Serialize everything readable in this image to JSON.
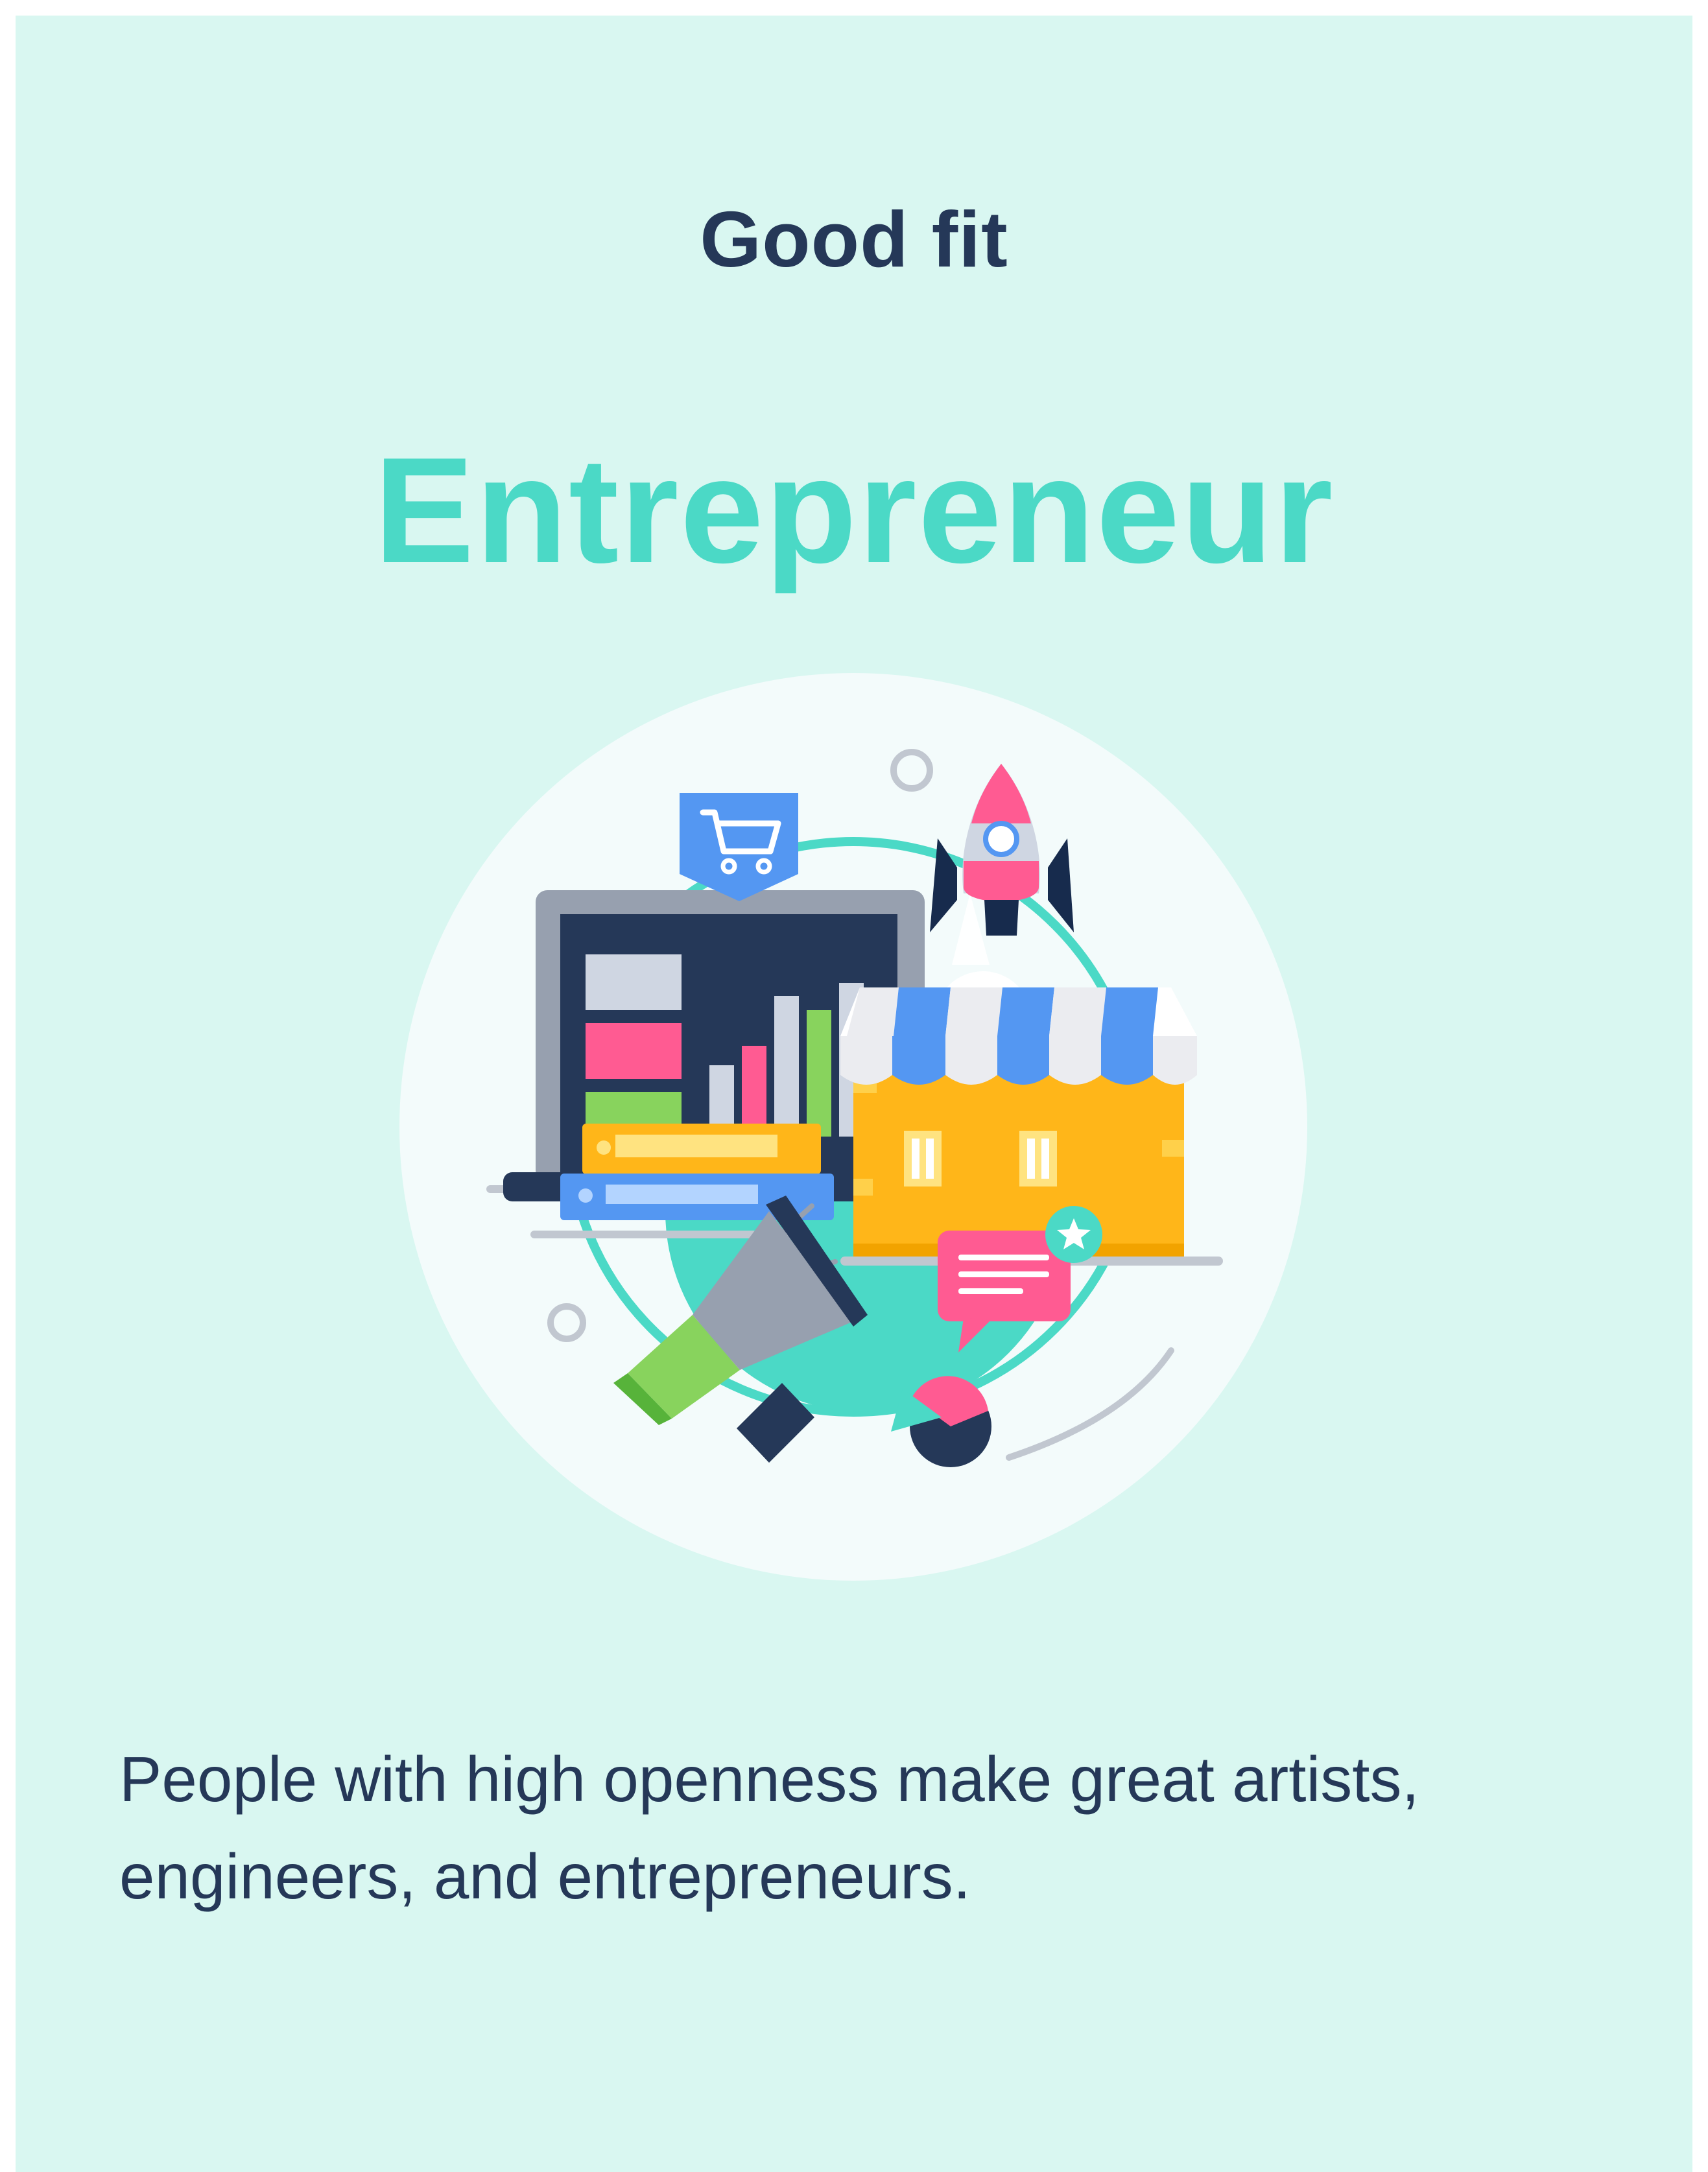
{
  "card": {
    "label": "Good fit",
    "title": "Entrepreneur",
    "description": "People with high openness make great artists, engineers, and entrepreneurs."
  },
  "illustration": {
    "subject": "entrepreneur",
    "icons": [
      "shopping-cart-icon",
      "laptop-chart-icon",
      "rocket-icon",
      "storefront-icon",
      "megaphone-icon",
      "chat-bubble-icon",
      "pie-chart-icon",
      "books-icon"
    ]
  },
  "colors": {
    "background": "#d9f7f1",
    "accent": "#4bd9c6",
    "text": "#253858"
  }
}
